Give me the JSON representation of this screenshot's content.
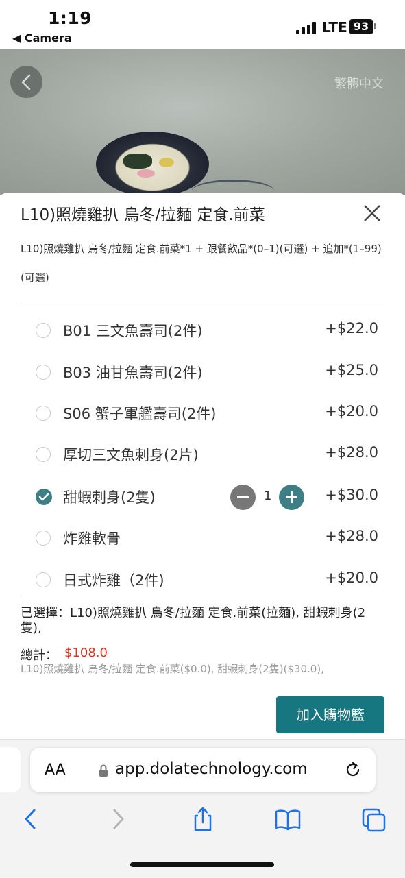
{
  "status": {
    "time": "1:19",
    "back_app": "◀ Camera",
    "network": "LTE",
    "battery": "93"
  },
  "hero": {
    "language": "繁體中文"
  },
  "dish": {
    "title": "L10)照燒雞扒 烏冬/拉麵 定食.前菜",
    "description": "L10)照燒雞扒 烏冬/拉麵 定食.前菜*1 + 跟餐飲品*(0–1)(可選) + 追加*(1–99)(可選)"
  },
  "options": [
    {
      "label": "B01 三文魚壽司(2件)",
      "price": "+$22.0",
      "selected": false
    },
    {
      "label": "B03 油甘魚壽司(2件)",
      "price": "+$25.0",
      "selected": false
    },
    {
      "label": "S06 蟹子軍艦壽司(2件)",
      "price": "+$20.0",
      "selected": false
    },
    {
      "label": "厚切三文魚刺身(2片)",
      "price": "+$28.0",
      "selected": false
    },
    {
      "label": "甜蝦刺身(2隻)",
      "price": "+$30.0",
      "selected": true,
      "quantity": "1"
    },
    {
      "label": "炸雞軟骨",
      "price": "+$28.0",
      "selected": false
    },
    {
      "label": "日式炸雞（2件)",
      "price": "+$20.0",
      "selected": false
    }
  ],
  "selection": {
    "selected_text": "已選擇：L10)照燒雞扒 烏冬/拉麵 定食.前菜(拉麵), 甜蝦刺身(2隻),",
    "total_label": "總計：",
    "total_value": "$108.0",
    "summary": "L10)照燒雞扒 烏冬/拉麵 定食.前菜($0.0), 甜蝦刺身(2隻)($30.0),"
  },
  "actions": {
    "add_to_cart": "加入購物籃"
  },
  "browser": {
    "aa_label": "AA",
    "url": "app.dolatechnology.com"
  },
  "colors": {
    "accent": "#177781",
    "check": "#3e7f86",
    "price_total": "#d9311e"
  }
}
